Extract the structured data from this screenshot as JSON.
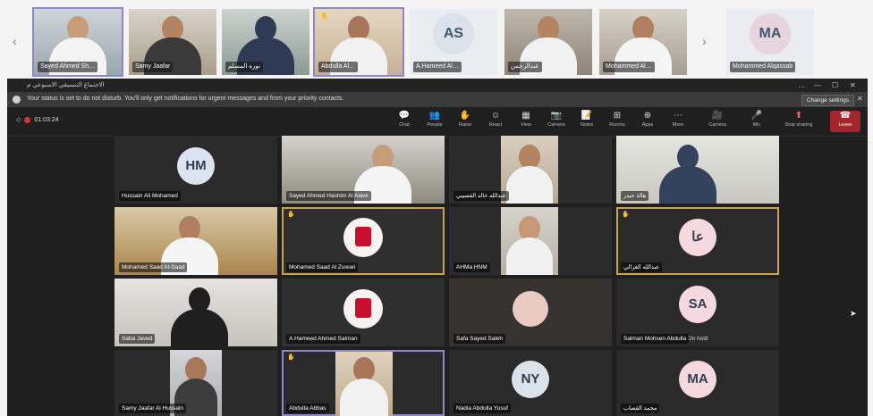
{
  "participant_strip": {
    "thumbnails": [
      {
        "name": "Sayed Ahmed Sh…",
        "selected": true
      },
      {
        "name": "Samy Jaafar",
        "selected": false
      },
      {
        "name": "نوره المسلم",
        "selected": false
      },
      {
        "name": "Abdulla Al…",
        "selected": true
      },
      {
        "name": "A.Hameed Al…",
        "selected": false,
        "initials": "AS"
      },
      {
        "name": "عبدالرحمن",
        "selected": false
      },
      {
        "name": "Mohammed Al…",
        "selected": false
      },
      {
        "name": "Mohammed Alqassab",
        "selected": false,
        "initials": "MA"
      }
    ],
    "prev_arrow": "‹",
    "next_arrow": "›"
  },
  "window": {
    "title": "الاجتماع التنسيقي الاسبوعي م",
    "controls": [
      "…",
      "—",
      "☐",
      "✕"
    ]
  },
  "banner": {
    "text": "Your status is set to do not disturb. You'll only get notifications for urgent messages and from your priority contacts.",
    "button": "Change settings",
    "close": "✕"
  },
  "toolbar": {
    "timer": "01:03:24",
    "buttons": [
      {
        "label": "Chat",
        "icon": "💬"
      },
      {
        "label": "People",
        "icon": "👥"
      },
      {
        "label": "Raise",
        "icon": "✋"
      },
      {
        "label": "React",
        "icon": "☺"
      },
      {
        "label": "View",
        "icon": "▦"
      },
      {
        "label": "Camera",
        "icon": "📷"
      },
      {
        "label": "Notes",
        "icon": "📝"
      },
      {
        "label": "Rooms",
        "icon": "⊞"
      },
      {
        "label": "Apps",
        "icon": "⊕"
      },
      {
        "label": "More",
        "icon": "⋯"
      },
      {
        "label": "Camera",
        "icon": "🎥"
      },
      {
        "label": "Mic",
        "icon": "🎤"
      },
      {
        "label": "Stop sharing",
        "icon": "⬆"
      },
      {
        "label": "Leave",
        "icon": "☎"
      }
    ]
  },
  "tiles": [
    {
      "name": "Hussain Ali Mohamed",
      "initials": "HM",
      "avatar_bg": "#dbe4f0"
    },
    {
      "name": "Sayed Ahmed Hashim Al Alawi",
      "avatar_bg": ""
    },
    {
      "name": "عبدالله خالد القصيبي",
      "avatar_bg": ""
    },
    {
      "name": "هالة حيدر",
      "avatar_bg": ""
    },
    {
      "name": "Mohamed Saad Al-Saad",
      "avatar_bg": ""
    },
    {
      "name": "Mohamed Saad Al Zuwari",
      "hand": "✋",
      "avatar_bg": ""
    },
    {
      "name": "AHMa HNM",
      "avatar_bg": ""
    },
    {
      "name": "عبدالله الغزالي",
      "initials": "عا",
      "hand": "✋",
      "avatar_bg": "#f6d9df"
    },
    {
      "name": "Saba Javed",
      "avatar_bg": ""
    },
    {
      "name": "A.Hameed Ahmed Salman",
      "avatar_bg": ""
    },
    {
      "name": "Safa Sayed Saleh",
      "avatar_bg": ""
    },
    {
      "name": "Salman Mohsen Abdulla",
      "initials": "SA",
      "subtext": "On hold",
      "avatar_bg": "#f6d9df"
    },
    {
      "name": "Samy Jaafar Al Hussain",
      "avatar_bg": ""
    },
    {
      "name": "Abdulla Abbas",
      "hand": "✋",
      "avatar_bg": ""
    },
    {
      "name": "Nadia Abdulla Yusuf",
      "initials": "NY",
      "avatar_bg": "#dbe2ec"
    },
    {
      "name": "محمد القصاب",
      "initials": "MA",
      "avatar_bg": "#f6d9df"
    }
  ]
}
